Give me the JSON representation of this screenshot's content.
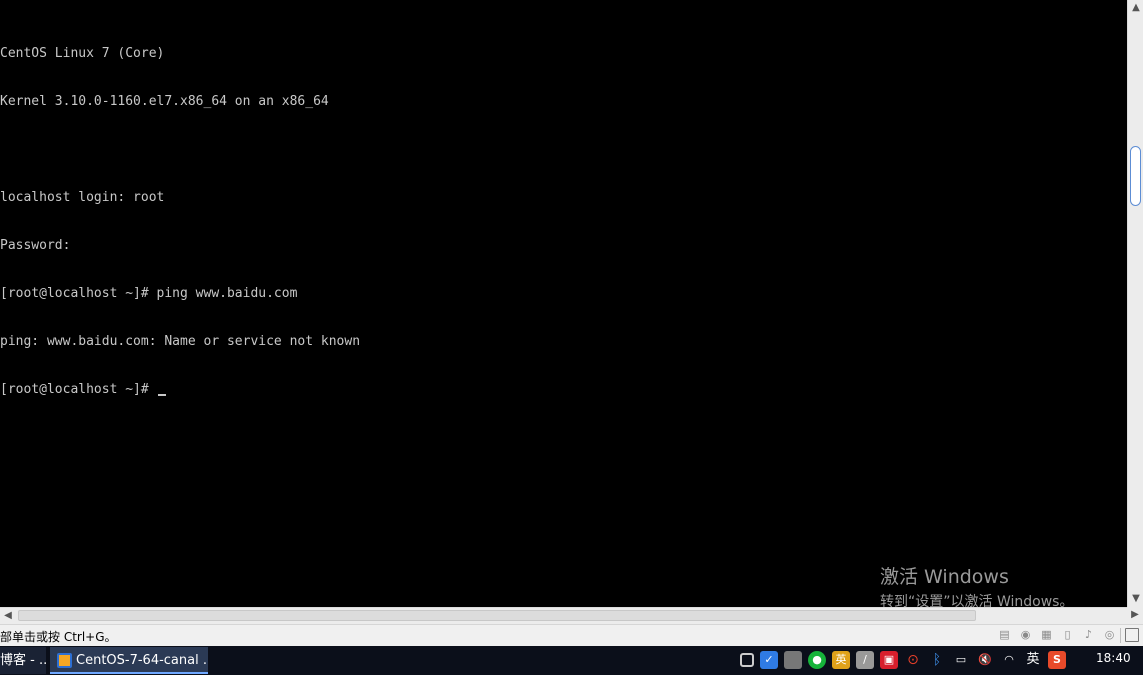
{
  "console": {
    "lines": [
      "CentOS Linux 7 (Core)",
      "Kernel 3.10.0-1160.el7.x86_64 on an x86_64",
      "",
      "localhost login: root",
      "Password:",
      "[root@localhost ~]# ping www.baidu.com",
      "ping: www.baidu.com: Name or service not known",
      "[root@localhost ~]# "
    ]
  },
  "watermark": {
    "title": "激活 Windows",
    "subtitle": "转到“设置”以激活 Windows。"
  },
  "statusbar": {
    "text": "部单击或按 Ctrl+G。"
  },
  "taskbar": {
    "tasks": [
      {
        "label": "博客 - ..."
      },
      {
        "label": "CentOS-7-64-canal ..."
      }
    ],
    "tray": {
      "ime_label": "英",
      "sogou_label": "S"
    },
    "clock": "18:40"
  },
  "colors": {
    "console_bg": "#000000",
    "console_fg": "#c8c8c8",
    "taskbar_bg": "#0b0f1a",
    "active_task_bg": "#2b3a55"
  }
}
